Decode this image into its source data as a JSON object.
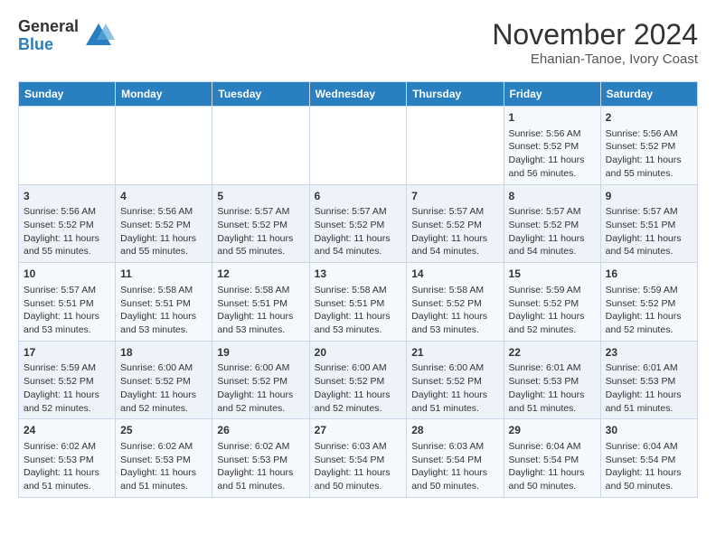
{
  "header": {
    "logo_general": "General",
    "logo_blue": "Blue",
    "month_title": "November 2024",
    "subtitle": "Ehanian-Tanoe, Ivory Coast"
  },
  "weekdays": [
    "Sunday",
    "Monday",
    "Tuesday",
    "Wednesday",
    "Thursday",
    "Friday",
    "Saturday"
  ],
  "weeks": [
    [
      {
        "day": "",
        "info": ""
      },
      {
        "day": "",
        "info": ""
      },
      {
        "day": "",
        "info": ""
      },
      {
        "day": "",
        "info": ""
      },
      {
        "day": "",
        "info": ""
      },
      {
        "day": "1",
        "info": "Sunrise: 5:56 AM\nSunset: 5:52 PM\nDaylight: 11 hours\nand 56 minutes."
      },
      {
        "day": "2",
        "info": "Sunrise: 5:56 AM\nSunset: 5:52 PM\nDaylight: 11 hours\nand 55 minutes."
      }
    ],
    [
      {
        "day": "3",
        "info": "Sunrise: 5:56 AM\nSunset: 5:52 PM\nDaylight: 11 hours\nand 55 minutes."
      },
      {
        "day": "4",
        "info": "Sunrise: 5:56 AM\nSunset: 5:52 PM\nDaylight: 11 hours\nand 55 minutes."
      },
      {
        "day": "5",
        "info": "Sunrise: 5:57 AM\nSunset: 5:52 PM\nDaylight: 11 hours\nand 55 minutes."
      },
      {
        "day": "6",
        "info": "Sunrise: 5:57 AM\nSunset: 5:52 PM\nDaylight: 11 hours\nand 54 minutes."
      },
      {
        "day": "7",
        "info": "Sunrise: 5:57 AM\nSunset: 5:52 PM\nDaylight: 11 hours\nand 54 minutes."
      },
      {
        "day": "8",
        "info": "Sunrise: 5:57 AM\nSunset: 5:52 PM\nDaylight: 11 hours\nand 54 minutes."
      },
      {
        "day": "9",
        "info": "Sunrise: 5:57 AM\nSunset: 5:51 PM\nDaylight: 11 hours\nand 54 minutes."
      }
    ],
    [
      {
        "day": "10",
        "info": "Sunrise: 5:57 AM\nSunset: 5:51 PM\nDaylight: 11 hours\nand 53 minutes."
      },
      {
        "day": "11",
        "info": "Sunrise: 5:58 AM\nSunset: 5:51 PM\nDaylight: 11 hours\nand 53 minutes."
      },
      {
        "day": "12",
        "info": "Sunrise: 5:58 AM\nSunset: 5:51 PM\nDaylight: 11 hours\nand 53 minutes."
      },
      {
        "day": "13",
        "info": "Sunrise: 5:58 AM\nSunset: 5:51 PM\nDaylight: 11 hours\nand 53 minutes."
      },
      {
        "day": "14",
        "info": "Sunrise: 5:58 AM\nSunset: 5:52 PM\nDaylight: 11 hours\nand 53 minutes."
      },
      {
        "day": "15",
        "info": "Sunrise: 5:59 AM\nSunset: 5:52 PM\nDaylight: 11 hours\nand 52 minutes."
      },
      {
        "day": "16",
        "info": "Sunrise: 5:59 AM\nSunset: 5:52 PM\nDaylight: 11 hours\nand 52 minutes."
      }
    ],
    [
      {
        "day": "17",
        "info": "Sunrise: 5:59 AM\nSunset: 5:52 PM\nDaylight: 11 hours\nand 52 minutes."
      },
      {
        "day": "18",
        "info": "Sunrise: 6:00 AM\nSunset: 5:52 PM\nDaylight: 11 hours\nand 52 minutes."
      },
      {
        "day": "19",
        "info": "Sunrise: 6:00 AM\nSunset: 5:52 PM\nDaylight: 11 hours\nand 52 minutes."
      },
      {
        "day": "20",
        "info": "Sunrise: 6:00 AM\nSunset: 5:52 PM\nDaylight: 11 hours\nand 52 minutes."
      },
      {
        "day": "21",
        "info": "Sunrise: 6:00 AM\nSunset: 5:52 PM\nDaylight: 11 hours\nand 51 minutes."
      },
      {
        "day": "22",
        "info": "Sunrise: 6:01 AM\nSunset: 5:53 PM\nDaylight: 11 hours\nand 51 minutes."
      },
      {
        "day": "23",
        "info": "Sunrise: 6:01 AM\nSunset: 5:53 PM\nDaylight: 11 hours\nand 51 minutes."
      }
    ],
    [
      {
        "day": "24",
        "info": "Sunrise: 6:02 AM\nSunset: 5:53 PM\nDaylight: 11 hours\nand 51 minutes."
      },
      {
        "day": "25",
        "info": "Sunrise: 6:02 AM\nSunset: 5:53 PM\nDaylight: 11 hours\nand 51 minutes."
      },
      {
        "day": "26",
        "info": "Sunrise: 6:02 AM\nSunset: 5:53 PM\nDaylight: 11 hours\nand 51 minutes."
      },
      {
        "day": "27",
        "info": "Sunrise: 6:03 AM\nSunset: 5:54 PM\nDaylight: 11 hours\nand 50 minutes."
      },
      {
        "day": "28",
        "info": "Sunrise: 6:03 AM\nSunset: 5:54 PM\nDaylight: 11 hours\nand 50 minutes."
      },
      {
        "day": "29",
        "info": "Sunrise: 6:04 AM\nSunset: 5:54 PM\nDaylight: 11 hours\nand 50 minutes."
      },
      {
        "day": "30",
        "info": "Sunrise: 6:04 AM\nSunset: 5:54 PM\nDaylight: 11 hours\nand 50 minutes."
      }
    ]
  ]
}
